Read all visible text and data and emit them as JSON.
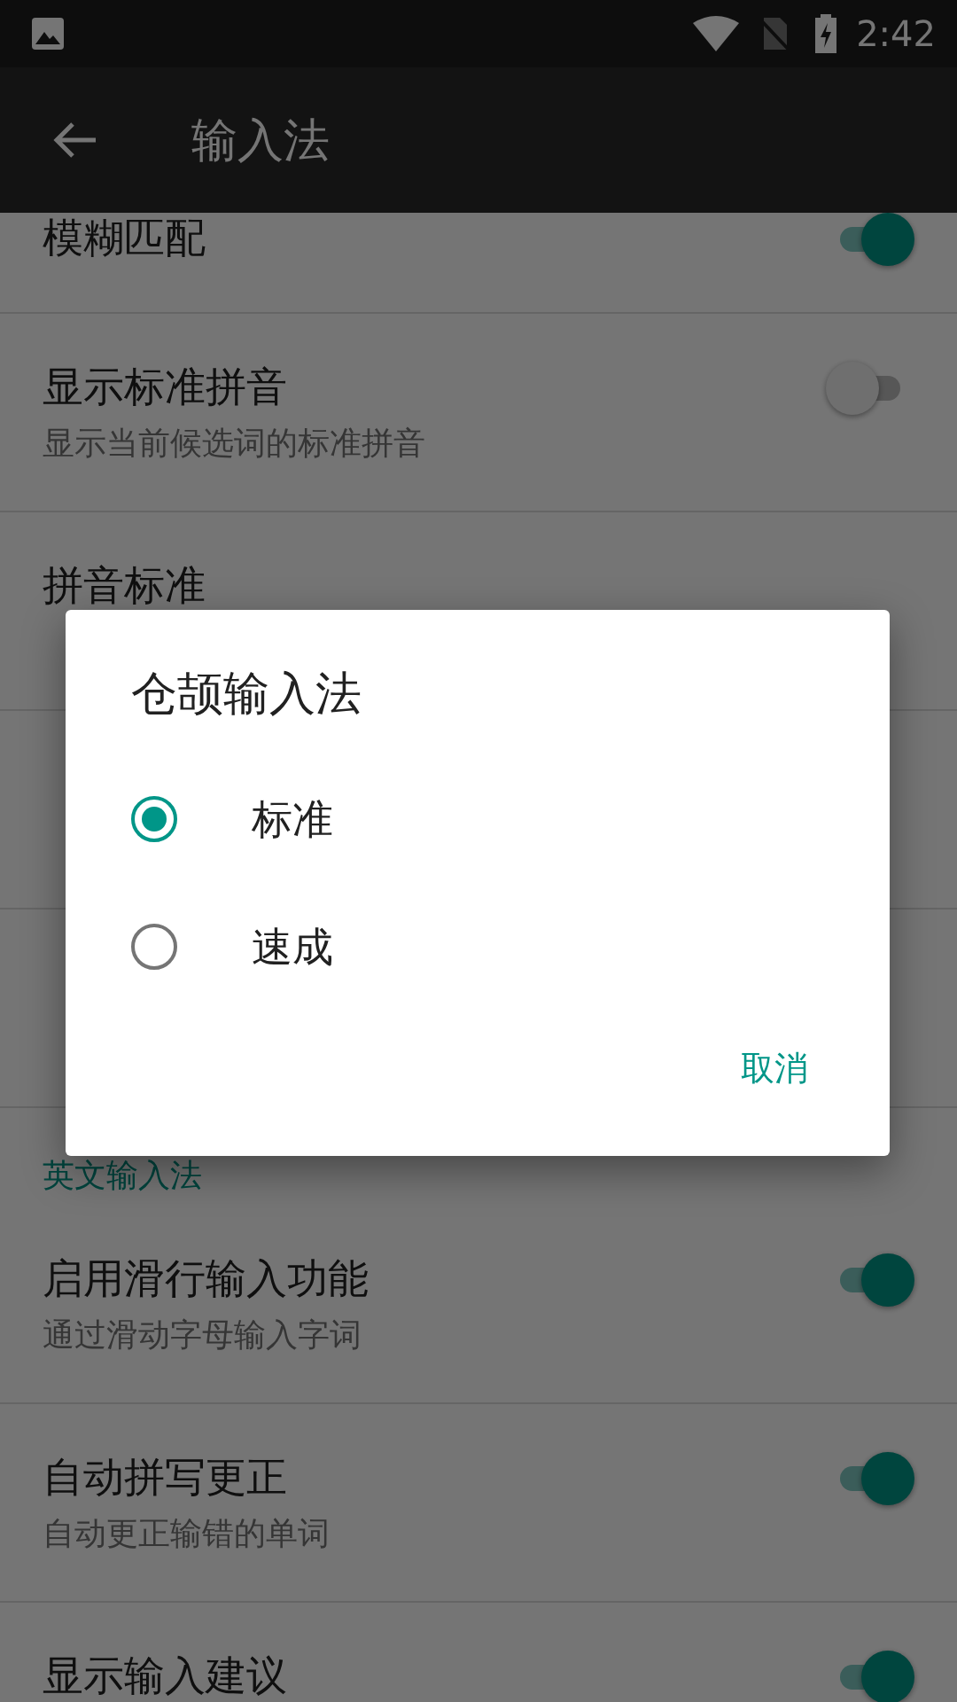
{
  "status_bar": {
    "time": "2:42"
  },
  "toolbar": {
    "title": "输入法"
  },
  "settings": [
    {
      "kind": "toggle",
      "title": "模糊匹配",
      "on": true
    },
    {
      "kind": "toggle",
      "title": "显示标准拼音",
      "subtitle": "显示当前候选词的标准拼音",
      "on": false
    },
    {
      "kind": "option",
      "title": "拼音标准"
    },
    {
      "kind": "option"
    },
    {
      "kind": "option"
    },
    {
      "kind": "header",
      "title": "英文输入法"
    },
    {
      "kind": "toggle",
      "title": "启用滑行输入功能",
      "subtitle": "通过滑动字母输入字词",
      "on": true
    },
    {
      "kind": "toggle",
      "title": "自动拼写更正",
      "subtitle": "自动更正输错的单词",
      "on": true
    },
    {
      "kind": "toggle",
      "title": "显示输入建议",
      "on": true
    }
  ],
  "dialog": {
    "title": "仓颉输入法",
    "options": [
      {
        "label": "标准",
        "selected": true
      },
      {
        "label": "速成",
        "selected": false
      }
    ],
    "buttons": [
      "取消"
    ]
  }
}
